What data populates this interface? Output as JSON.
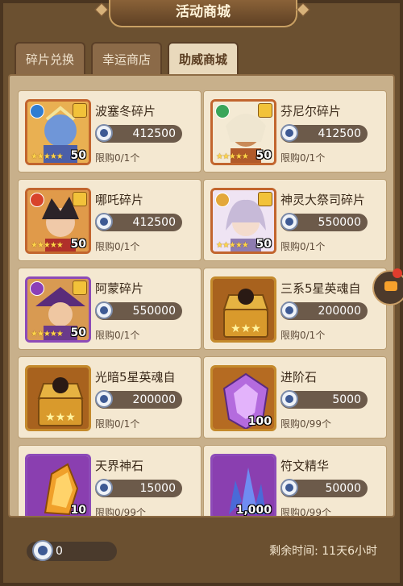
{
  "title": "活动商城",
  "tabs": [
    {
      "label": "碎片兑换",
      "active": false
    },
    {
      "label": "幸运商店",
      "active": false
    },
    {
      "label": "助威商城",
      "active": true
    }
  ],
  "items": [
    {
      "name": "波塞冬碎片",
      "price": "412500",
      "limit": "限购0/1个",
      "level": "50",
      "icon": "hero-poseidon-portrait",
      "element_color": "#2f7dd1"
    },
    {
      "name": "芬尼尔碎片",
      "price": "412500",
      "limit": "限购0/1个",
      "level": "50",
      "icon": "hero-fenrir-portrait",
      "element_color": "#3aa55a"
    },
    {
      "name": "哪吒碎片",
      "price": "412500",
      "limit": "限购0/1个",
      "level": "50",
      "icon": "hero-nezha-portrait",
      "element_color": "#d8432b"
    },
    {
      "name": "神灵大祭司碎片",
      "price": "550000",
      "limit": "限购0/1个",
      "level": "50",
      "icon": "hero-high-priestess-portrait",
      "element_color": "#e3a73a"
    },
    {
      "name": "阿蒙碎片",
      "price": "550000",
      "limit": "限购0/1个",
      "level": "50",
      "icon": "hero-amon-portrait",
      "element_color": "#8b3fb8"
    },
    {
      "name": "三系5星英魂自",
      "price": "200000",
      "limit": "限购0/1个",
      "level": "",
      "icon": "treasure-chest-icon",
      "element_color": ""
    },
    {
      "name": "光暗5星英魂自",
      "price": "200000",
      "limit": "限购0/1个",
      "level": "",
      "icon": "treasure-chest-icon",
      "element_color": ""
    },
    {
      "name": "进阶石",
      "price": "5000",
      "limit": "限购0/99个",
      "level": "100",
      "icon": "advance-stone-icon",
      "element_color": ""
    },
    {
      "name": "天界神石",
      "price": "15000",
      "limit": "限购0/99个",
      "level": "10",
      "icon": "celestial-stone-icon",
      "element_color": ""
    },
    {
      "name": "符文精华",
      "price": "50000",
      "limit": "限购0/99个",
      "level": "1,000",
      "icon": "rune-essence-icon",
      "element_color": ""
    }
  ],
  "wallet": {
    "balance": "0",
    "icon": "cheer-coin-icon"
  },
  "timer": {
    "label": "剩余时间: 11天6小时"
  },
  "colors": {
    "panel": "#c8b08b",
    "card": "#f4e8d1",
    "frame": "#6b5030",
    "price_pill": "#6c5a4a"
  }
}
